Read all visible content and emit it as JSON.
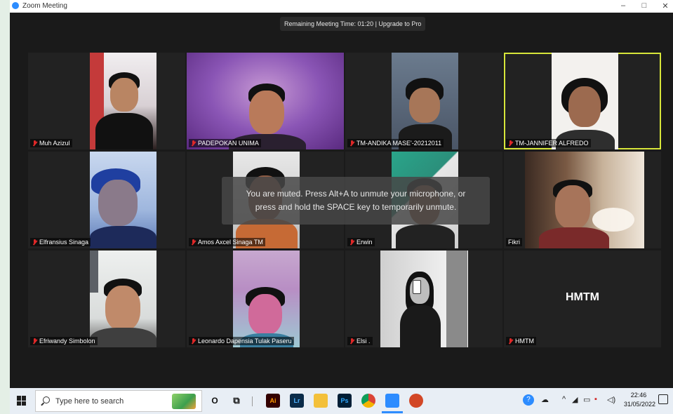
{
  "window": {
    "title": "Zoom Meeting",
    "controls": {
      "minimize": "–",
      "maximize": "□",
      "close": "✕"
    }
  },
  "meeting": {
    "remaining_time": "Remaining Meeting Time: 01:20 | Upgrade to Pro"
  },
  "participants": [
    {
      "name": "Muh Azizul",
      "muted": true
    },
    {
      "name": "PADEPOKAN UNIMA",
      "muted": true
    },
    {
      "name": "TM-ANDIKA MASE'-20212011",
      "muted": true
    },
    {
      "name": "TM-JANNIFER ALFREDO",
      "muted": true,
      "active_speaker": true
    },
    {
      "name": "Elfransius Sinaga",
      "muted": true
    },
    {
      "name": "Amos Axcel Sinaga TM",
      "muted": true
    },
    {
      "name": "Erwin",
      "muted": true
    },
    {
      "name": "Fikri",
      "muted": false
    },
    {
      "name": "Efriwandy Simbolon",
      "muted": true
    },
    {
      "name": "Leonardo Dapensia Tulak Paseru",
      "muted": true
    },
    {
      "name": "Elsi .",
      "muted": true
    },
    {
      "name": "HMTM",
      "muted": true,
      "video_off_label": "HMTM"
    }
  ],
  "toast": {
    "line1": "You are muted. Press Alt+A to unmute your microphone, or",
    "line2": "press and hold the SPACE key to temporarily unmute."
  },
  "taskbar": {
    "search_placeholder": "Type here to search",
    "apps": [
      {
        "icon": "cortana-icon",
        "label": "O"
      },
      {
        "icon": "task-view-icon",
        "label": "⧉"
      },
      {
        "icon": "illustrator-icon",
        "label": "Ai",
        "color": "#330000"
      },
      {
        "icon": "lightroom-icon",
        "label": "Lr",
        "color": "#0a2b49"
      },
      {
        "icon": "file-explorer-icon",
        "label": "",
        "color": "#f3c03a"
      },
      {
        "icon": "photoshop-icon",
        "label": "Ps",
        "color": "#001e36"
      },
      {
        "icon": "chrome-icon",
        "label": "",
        "color": "#e04a3c"
      },
      {
        "icon": "zoom-icon",
        "label": "",
        "color": "#2d8cff"
      },
      {
        "icon": "powerpoint-icon",
        "label": "",
        "color": "#d24726"
      }
    ],
    "time": "22:46",
    "date": "31/05/2022"
  }
}
